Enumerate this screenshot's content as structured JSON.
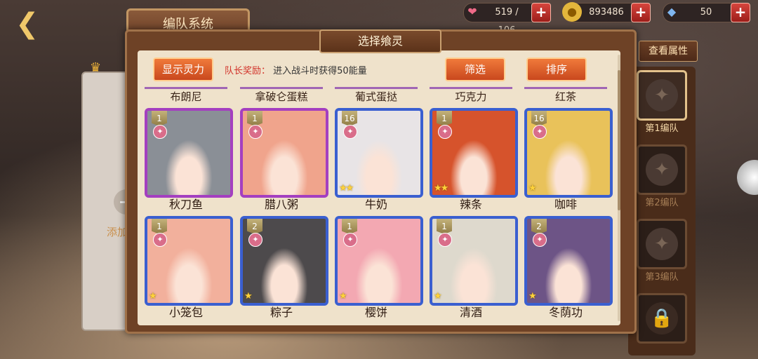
{
  "header": {
    "back_label": "",
    "system_title": "编队系统",
    "hp": "519 / 106",
    "gold": "893486",
    "gems": "50",
    "plus": "+"
  },
  "dialog": {
    "title": "选择飨灵",
    "show_spirit": "显示灵力",
    "reward_key": "队长奖励：",
    "reward_text": "进入战斗时获得50能量",
    "filter": "筛选",
    "sort": "排序"
  },
  "top_names": [
    "布朗尼",
    "拿破仑蛋糕",
    "葡式蛋挞",
    "巧克力",
    "红茶"
  ],
  "row1": [
    {
      "name": "秋刀鱼",
      "level": "1",
      "stars": "",
      "rarity": "purple",
      "hue": "#8a8f96"
    },
    {
      "name": "腊八粥",
      "level": "1",
      "stars": "",
      "rarity": "purple",
      "hue": "#f0a48c"
    },
    {
      "name": "牛奶",
      "level": "16",
      "stars": "★★",
      "rarity": "blue",
      "hue": "#e8e4e6"
    },
    {
      "name": "辣条",
      "level": "1",
      "stars": "★★",
      "rarity": "blue",
      "hue": "#d6532c"
    },
    {
      "name": "咖啡",
      "level": "16",
      "stars": "★",
      "rarity": "blue",
      "hue": "#e9c25a"
    }
  ],
  "row2": [
    {
      "name": "小笼包",
      "level": "1",
      "stars": "★",
      "rarity": "blue",
      "hue": "#f2b09c"
    },
    {
      "name": "粽子",
      "level": "2",
      "stars": "★",
      "rarity": "blue",
      "hue": "#4d4a4c"
    },
    {
      "name": "樱饼",
      "level": "1",
      "stars": "★",
      "rarity": "blue",
      "hue": "#f3a8b2"
    },
    {
      "name": "清酒",
      "level": "1",
      "stars": "★",
      "rarity": "blue",
      "hue": "#ded9cd"
    },
    {
      "name": "冬荫功",
      "level": "2",
      "stars": "★",
      "rarity": "blue",
      "hue": "#6d5486"
    }
  ],
  "side": {
    "view_attr": "查看属性",
    "teams": [
      "第1编队",
      "第2编队",
      "第3编队"
    ],
    "add_label": "添加"
  }
}
